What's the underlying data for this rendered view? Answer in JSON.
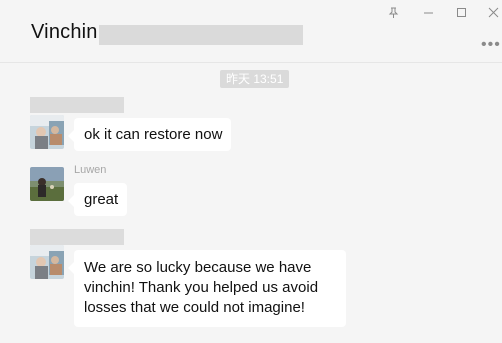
{
  "chat": {
    "title": "Vinchin"
  },
  "window": {
    "pin_icon": "pin-icon",
    "minimize_icon": "minimize-icon",
    "maximize_icon": "maximize-icon",
    "close_icon": "close-icon",
    "more_icon": "more-icon"
  },
  "timestamp": "昨天 13:51",
  "messages": [
    {
      "text": "ok it can restore now"
    },
    {
      "sender": "Luwen",
      "text": "great"
    },
    {
      "text": "We are so lucky because we have vinchin!  Thank you helped us avoid losses that we could not imagine!"
    }
  ],
  "colors": {
    "background": "#f5f5f5",
    "bubble": "#ffffff",
    "redaction": "#dadada"
  }
}
